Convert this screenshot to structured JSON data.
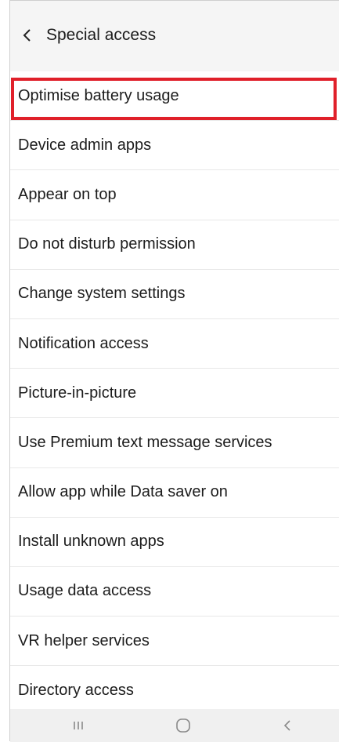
{
  "header": {
    "title": "Special access"
  },
  "items": [
    {
      "label": "Optimise battery usage",
      "highlighted": true
    },
    {
      "label": "Device admin apps"
    },
    {
      "label": "Appear on top"
    },
    {
      "label": "Do not disturb permission"
    },
    {
      "label": "Change system settings"
    },
    {
      "label": "Notification access"
    },
    {
      "label": "Picture-in-picture"
    },
    {
      "label": "Use Premium text message services"
    },
    {
      "label": "Allow app while Data saver on"
    },
    {
      "label": "Install unknown apps"
    },
    {
      "label": "Usage data access"
    },
    {
      "label": "VR helper services"
    },
    {
      "label": "Directory access"
    }
  ],
  "navbar": {
    "icons": [
      "recents-icon",
      "home-icon",
      "back-icon"
    ]
  },
  "colors": {
    "highlight": "#e0202a",
    "background": "#f7f7f7",
    "list_background": "#ffffff",
    "divider": "#e8e8e8"
  }
}
